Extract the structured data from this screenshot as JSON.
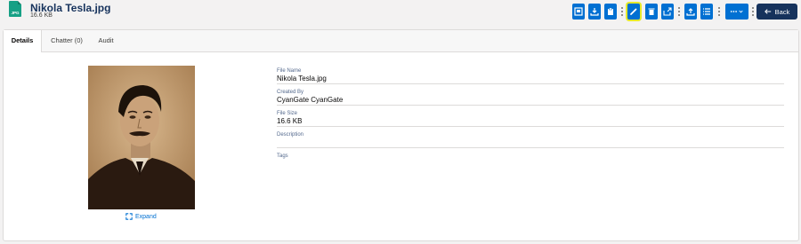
{
  "header": {
    "title": "Nikola Tesla.jpg",
    "size": "16.6 KB",
    "file_badge": "JPG",
    "back_label": "Back"
  },
  "actions": [
    {
      "icon": "preview-icon"
    },
    {
      "icon": "download-icon"
    },
    {
      "icon": "copy-icon"
    },
    {
      "icon": "edit-icon",
      "highlighted": true
    },
    {
      "icon": "delete-icon"
    },
    {
      "icon": "share-icon"
    },
    {
      "icon": "upload-icon"
    },
    {
      "icon": "list-icon"
    },
    {
      "icon": "more-icon"
    }
  ],
  "tabs": [
    {
      "label": "Details",
      "active": true
    },
    {
      "label": "Chatter (0)",
      "active": false
    },
    {
      "label": "Audit",
      "active": false
    }
  ],
  "preview": {
    "expand_label": "Expand"
  },
  "fields": [
    {
      "label": "File Name",
      "value": "Nikola Tesla.jpg"
    },
    {
      "label": "Created By",
      "value": "CyanGate CyanGate"
    },
    {
      "label": "File Size",
      "value": "16.6 KB"
    },
    {
      "label": "Description",
      "value": ""
    },
    {
      "label": "Tags",
      "value": ""
    }
  ]
}
